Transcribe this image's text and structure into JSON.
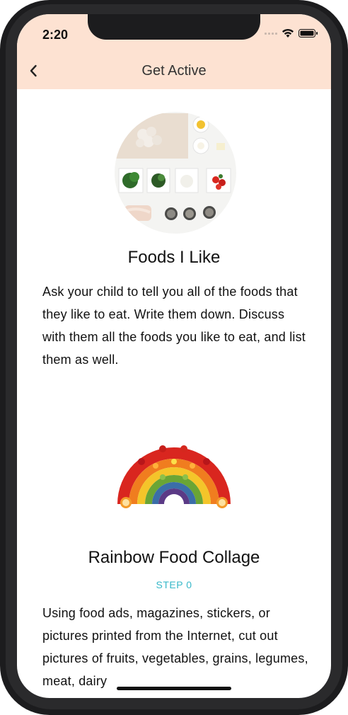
{
  "status": {
    "time": "2:20"
  },
  "nav": {
    "title": "Get Active"
  },
  "activities": [
    {
      "title": "Foods I Like",
      "image": "ingredients-photo",
      "description": "Ask your child to tell you all of the foods that they like to eat. Write them down. Discuss with them all the foods you like to eat, and list them as well."
    },
    {
      "title": "Rainbow Food Collage",
      "image": "rainbow-food-photo",
      "step": "STEP 0",
      "description": "Using food ads, magazines, stickers, or pictures printed from the Internet, cut out pictures of fruits, vegetables, grains, legumes, meat, dairy"
    }
  ],
  "colors": {
    "header_bg": "#fde2d2",
    "step_accent": "#38b8c9"
  }
}
